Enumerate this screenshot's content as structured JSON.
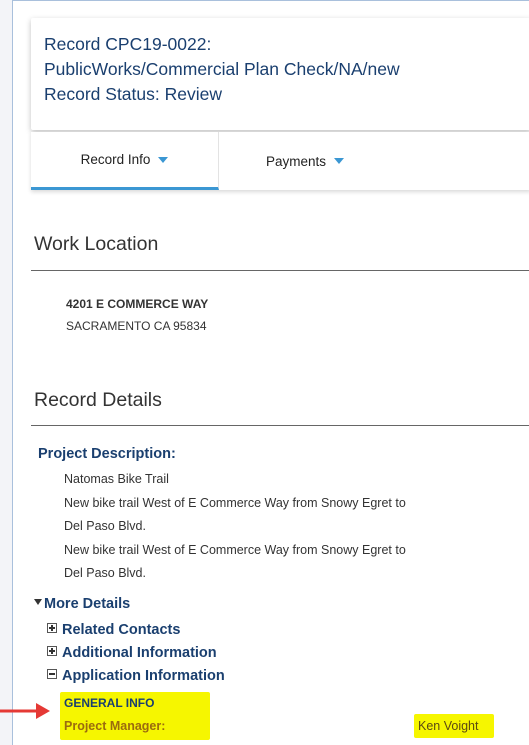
{
  "header": {
    "record_line": "Record CPC19-0022:",
    "type_line": "PublicWorks/Commercial Plan Check/NA/new",
    "status_line": "Record Status: Review"
  },
  "tabs": [
    {
      "label": "Record Info"
    },
    {
      "label": "Payments"
    }
  ],
  "work_location": {
    "title": "Work Location",
    "address_line1": "4201 E COMMERCE WAY",
    "address_line2": "SACRAMENTO CA 95834"
  },
  "record_details": {
    "title": "Record Details",
    "project_description_label": "Project Description:",
    "project_name": "Natomas Bike Trail",
    "description_lines": [
      "New bike trail West of E Commerce Way from Snowy Egret to",
      "Del Paso Blvd.",
      "New bike trail West of E Commerce Way from Snowy Egret to",
      "Del Paso Blvd."
    ],
    "more_details_label": "More Details",
    "related_contacts_label": "Related Contacts",
    "additional_information_label": "Additional Information",
    "application_information_label": "Application Information",
    "general_info_label": "GENERAL INFO",
    "project_manager_label": "Project Manager:",
    "project_manager_value": "Ken Voight"
  },
  "colors": {
    "brand_blue": "#1a3f6f",
    "accent_blue": "#3b97d3",
    "highlight": "#f6f600",
    "arrow_red": "#e53935"
  },
  "icons": [
    "dropdown-caret-icon",
    "collapse-triangle-icon",
    "expand-plus-icon",
    "collapse-minus-icon",
    "annotation-arrow-icon"
  ]
}
